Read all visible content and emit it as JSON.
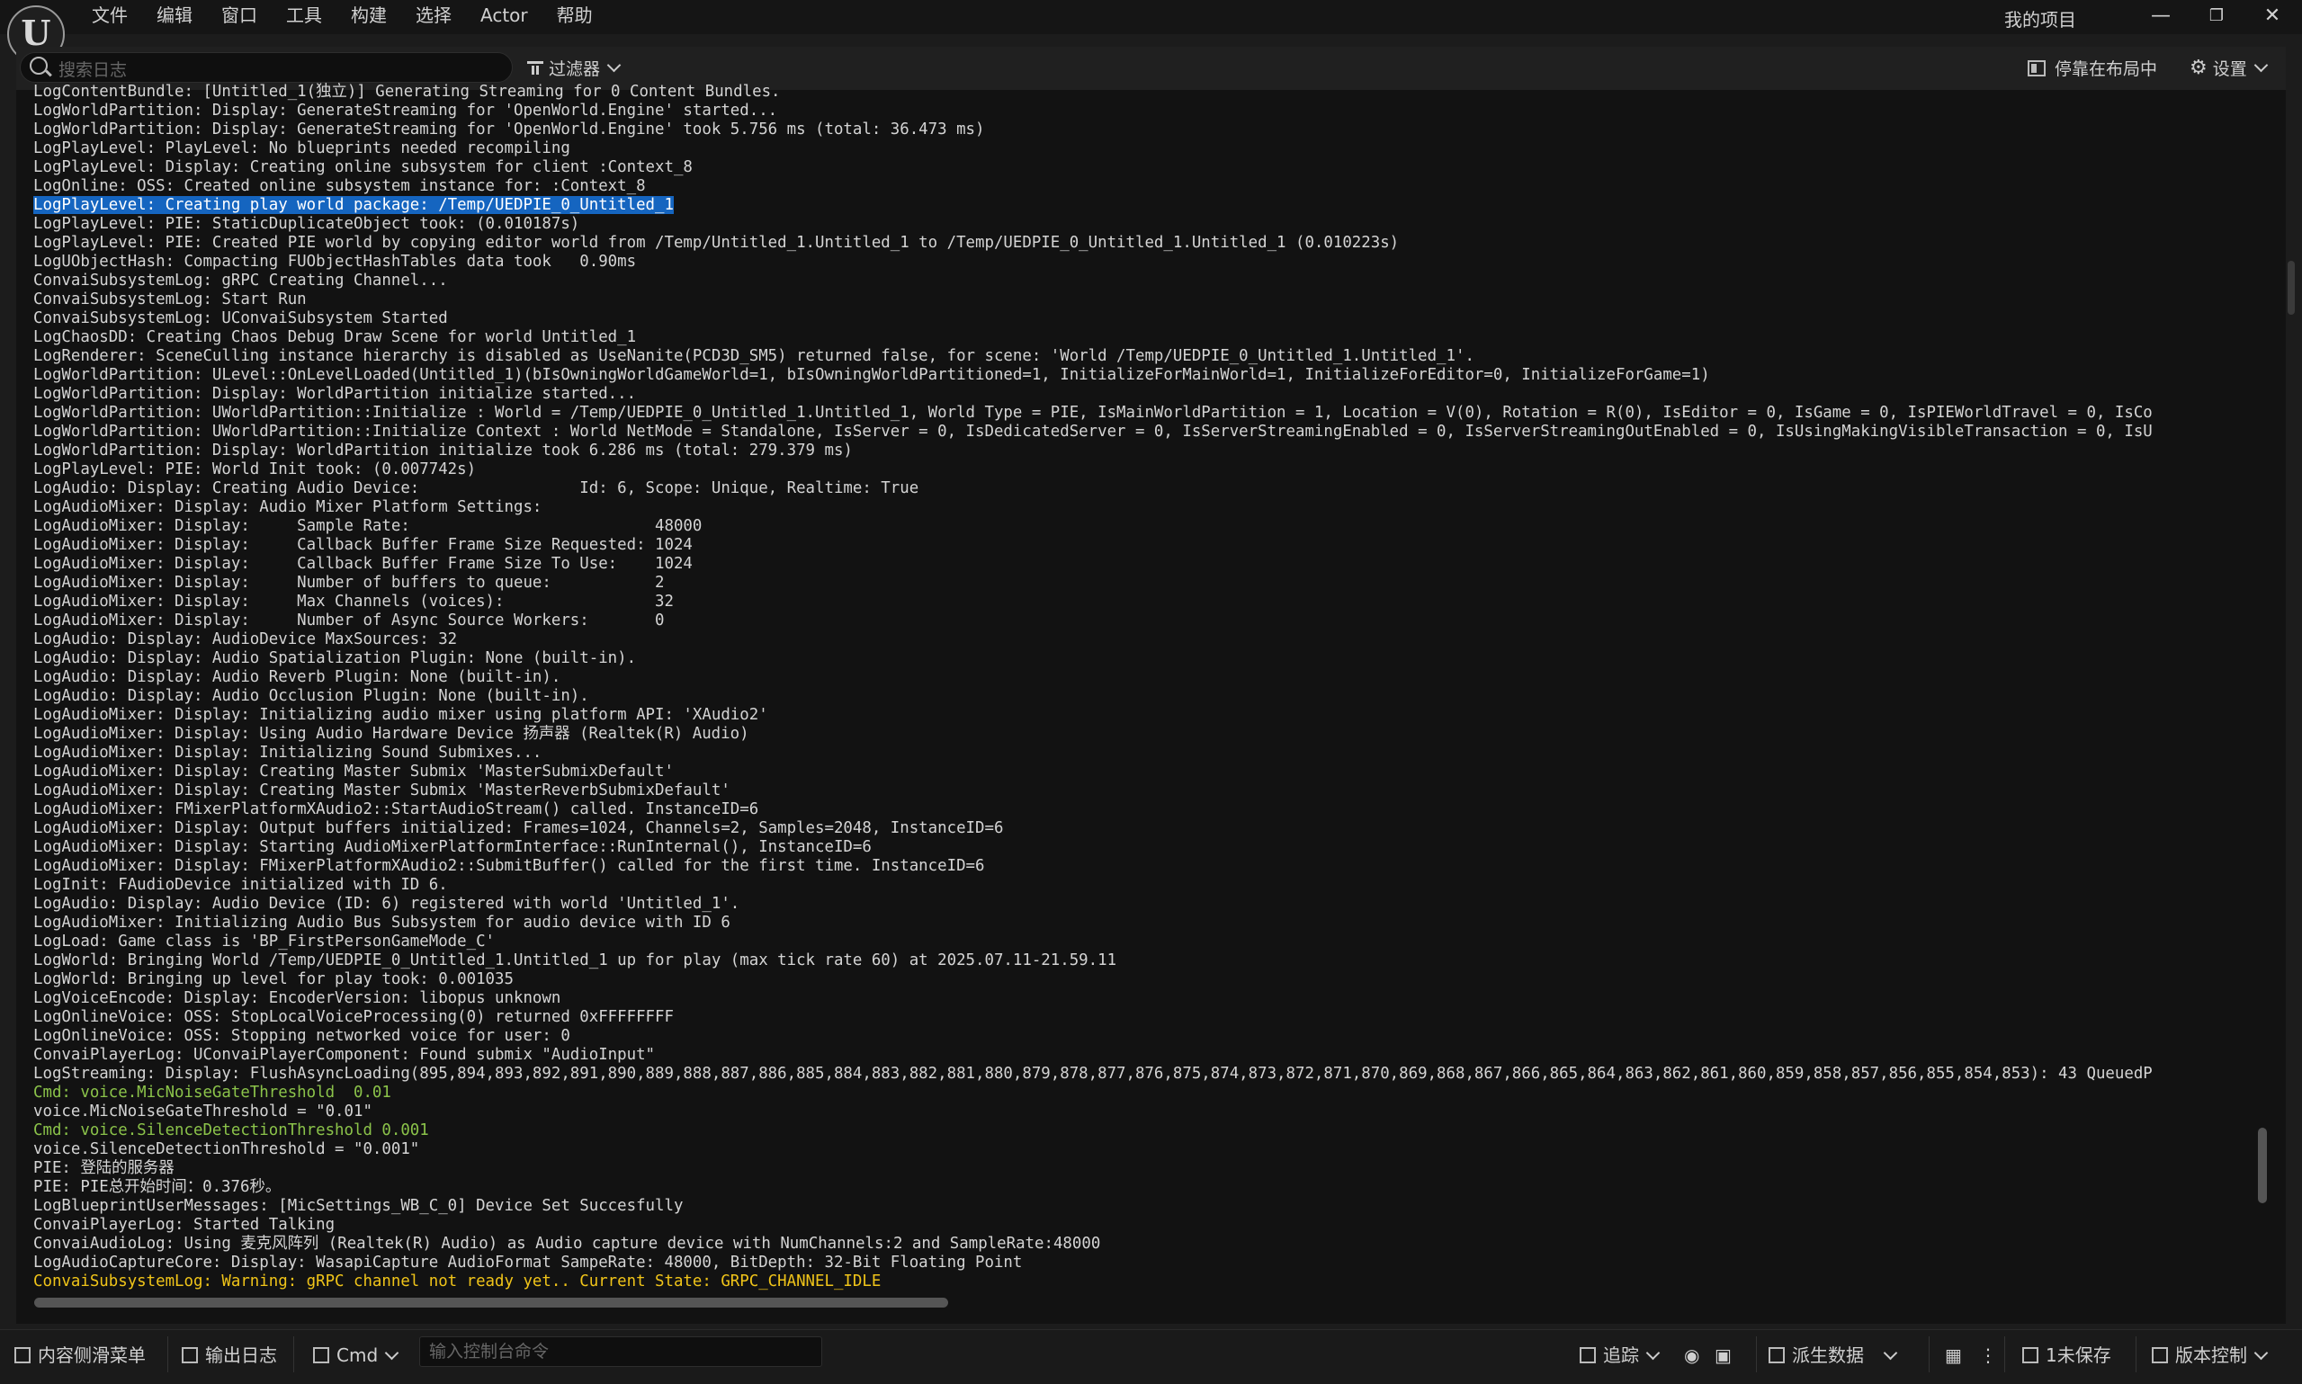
{
  "menu": {
    "items": [
      "文件",
      "编辑",
      "窗口",
      "工具",
      "构建",
      "选择",
      "Actor",
      "帮助"
    ],
    "project_name": "我的项目"
  },
  "toolbar": {
    "search_placeholder": "搜索日志",
    "filter_label": "过滤器",
    "dock_label": "停靠在布局中",
    "settings_label": "设置"
  },
  "log": {
    "lines": [
      {
        "text": "LogContentBundle: [Untitled_1(独立)] Generating Streaming for 0 Content Bundles.",
        "kind": "normal"
      },
      {
        "text": "LogWorldPartition: Display: GenerateStreaming for 'OpenWorld.Engine' started...",
        "kind": "normal"
      },
      {
        "text": "LogWorldPartition: Display: GenerateStreaming for 'OpenWorld.Engine' took 5.756 ms (total: 36.473 ms)",
        "kind": "normal"
      },
      {
        "text": "LogPlayLevel: PlayLevel: No blueprints needed recompiling",
        "kind": "normal"
      },
      {
        "text": "LogPlayLevel: Display: Creating online subsystem for client :Context_8",
        "kind": "normal"
      },
      {
        "text": "LogOnline: OSS: Created online subsystem instance for: :Context_8",
        "kind": "normal"
      },
      {
        "text": "LogPlayLevel: Creating play world package: /Temp/UEDPIE_0_Untitled_1",
        "kind": "selected"
      },
      {
        "text": "LogPlayLevel: PIE: StaticDuplicateObject took: (0.010187s)",
        "kind": "normal"
      },
      {
        "text": "LogPlayLevel: PIE: Created PIE world by copying editor world from /Temp/Untitled_1.Untitled_1 to /Temp/UEDPIE_0_Untitled_1.Untitled_1 (0.010223s)",
        "kind": "normal"
      },
      {
        "text": "LogUObjectHash: Compacting FUObjectHashTables data took   0.90ms",
        "kind": "normal"
      },
      {
        "text": "ConvaiSubsystemLog: gRPC Creating Channel...",
        "kind": "normal"
      },
      {
        "text": "ConvaiSubsystemLog: Start Run",
        "kind": "normal"
      },
      {
        "text": "ConvaiSubsystemLog: UConvaiSubsystem Started",
        "kind": "normal"
      },
      {
        "text": "LogChaosDD: Creating Chaos Debug Draw Scene for world Untitled_1",
        "kind": "normal"
      },
      {
        "text": "LogRenderer: SceneCulling instance hierarchy is disabled as UseNanite(PCD3D_SM5) returned false, for scene: 'World /Temp/UEDPIE_0_Untitled_1.Untitled_1'.",
        "kind": "normal"
      },
      {
        "text": "LogWorldPartition: ULevel::OnLevelLoaded(Untitled_1)(bIsOwningWorldGameWorld=1, bIsOwningWorldPartitioned=1, InitializeForMainWorld=1, InitializeForEditor=0, InitializeForGame=1)",
        "kind": "normal"
      },
      {
        "text": "LogWorldPartition: Display: WorldPartition initialize started...",
        "kind": "normal"
      },
      {
        "text": "LogWorldPartition: UWorldPartition::Initialize : World = /Temp/UEDPIE_0_Untitled_1.Untitled_1, World Type = PIE, IsMainWorldPartition = 1, Location = V(0), Rotation = R(0), IsEditor = 0, IsGame = 0, IsPIEWorldTravel = 0, IsCo",
        "kind": "normal"
      },
      {
        "text": "LogWorldPartition: UWorldPartition::Initialize Context : World NetMode = Standalone, IsServer = 0, IsDedicatedServer = 0, IsServerStreamingEnabled = 0, IsServerStreamingOutEnabled = 0, IsUsingMakingVisibleTransaction = 0, IsU",
        "kind": "normal"
      },
      {
        "text": "LogWorldPartition: Display: WorldPartition initialize took 6.286 ms (total: 279.379 ms)",
        "kind": "normal"
      },
      {
        "text": "LogPlayLevel: PIE: World Init took: (0.007742s)",
        "kind": "normal"
      },
      {
        "text": "LogAudio: Display: Creating Audio Device:                 Id: 6, Scope: Unique, Realtime: True",
        "kind": "normal"
      },
      {
        "text": "LogAudioMixer: Display: Audio Mixer Platform Settings:",
        "kind": "normal"
      },
      {
        "text": "LogAudioMixer: Display:     Sample Rate:                          48000",
        "kind": "normal"
      },
      {
        "text": "LogAudioMixer: Display:     Callback Buffer Frame Size Requested: 1024",
        "kind": "normal"
      },
      {
        "text": "LogAudioMixer: Display:     Callback Buffer Frame Size To Use:    1024",
        "kind": "normal"
      },
      {
        "text": "LogAudioMixer: Display:     Number of buffers to queue:           2",
        "kind": "normal"
      },
      {
        "text": "LogAudioMixer: Display:     Max Channels (voices):                32",
        "kind": "normal"
      },
      {
        "text": "LogAudioMixer: Display:     Number of Async Source Workers:       0",
        "kind": "normal"
      },
      {
        "text": "LogAudio: Display: AudioDevice MaxSources: 32",
        "kind": "normal"
      },
      {
        "text": "LogAudio: Display: Audio Spatialization Plugin: None (built-in).",
        "kind": "normal"
      },
      {
        "text": "LogAudio: Display: Audio Reverb Plugin: None (built-in).",
        "kind": "normal"
      },
      {
        "text": "LogAudio: Display: Audio Occlusion Plugin: None (built-in).",
        "kind": "normal"
      },
      {
        "text": "LogAudioMixer: Display: Initializing audio mixer using platform API: 'XAudio2'",
        "kind": "normal"
      },
      {
        "text": "LogAudioMixer: Display: Using Audio Hardware Device 扬声器 (Realtek(R) Audio)",
        "kind": "normal"
      },
      {
        "text": "LogAudioMixer: Display: Initializing Sound Submixes...",
        "kind": "normal"
      },
      {
        "text": "LogAudioMixer: Display: Creating Master Submix 'MasterSubmixDefault'",
        "kind": "normal"
      },
      {
        "text": "LogAudioMixer: Display: Creating Master Submix 'MasterReverbSubmixDefault'",
        "kind": "normal"
      },
      {
        "text": "LogAudioMixer: FMixerPlatformXAudio2::StartAudioStream() called. InstanceID=6",
        "kind": "normal"
      },
      {
        "text": "LogAudioMixer: Display: Output buffers initialized: Frames=1024, Channels=2, Samples=2048, InstanceID=6",
        "kind": "normal"
      },
      {
        "text": "LogAudioMixer: Display: Starting AudioMixerPlatformInterface::RunInternal(), InstanceID=6",
        "kind": "normal"
      },
      {
        "text": "LogAudioMixer: Display: FMixerPlatformXAudio2::SubmitBuffer() called for the first time. InstanceID=6",
        "kind": "normal"
      },
      {
        "text": "LogInit: FAudioDevice initialized with ID 6.",
        "kind": "normal"
      },
      {
        "text": "LogAudio: Display: Audio Device (ID: 6) registered with world 'Untitled_1'.",
        "kind": "normal"
      },
      {
        "text": "LogAudioMixer: Initializing Audio Bus Subsystem for audio device with ID 6",
        "kind": "normal"
      },
      {
        "text": "LogLoad: Game class is 'BP_FirstPersonGameMode_C'",
        "kind": "normal"
      },
      {
        "text": "LogWorld: Bringing World /Temp/UEDPIE_0_Untitled_1.Untitled_1 up for play (max tick rate 60) at 2025.07.11-21.59.11",
        "kind": "normal"
      },
      {
        "text": "LogWorld: Bringing up level for play took: 0.001035",
        "kind": "normal"
      },
      {
        "text": "LogVoiceEncode: Display: EncoderVersion: libopus unknown",
        "kind": "normal"
      },
      {
        "text": "LogOnlineVoice: OSS: StopLocalVoiceProcessing(0) returned 0xFFFFFFFF",
        "kind": "normal"
      },
      {
        "text": "LogOnlineVoice: OSS: Stopping networked voice for user: 0",
        "kind": "normal"
      },
      {
        "text": "ConvaiPlayerLog: UConvaiPlayerComponent: Found submix \"AudioInput\"",
        "kind": "normal"
      },
      {
        "text": "LogStreaming: Display: FlushAsyncLoading(895,894,893,892,891,890,889,888,887,886,885,884,883,882,881,880,879,878,877,876,875,874,873,872,871,870,869,868,867,866,865,864,863,862,861,860,859,858,857,856,855,854,853): 43 QueuedP",
        "kind": "normal"
      },
      {
        "text": "Cmd: voice.MicNoiseGateThreshold  0.01",
        "kind": "cmd"
      },
      {
        "text": "voice.MicNoiseGateThreshold = \"0.01\"",
        "kind": "normal"
      },
      {
        "text": "Cmd: voice.SilenceDetectionThreshold 0.001",
        "kind": "cmd"
      },
      {
        "text": "voice.SilenceDetectionThreshold = \"0.001\"",
        "kind": "normal"
      },
      {
        "text": "PIE: 登陆的服务器",
        "kind": "normal"
      },
      {
        "text": "PIE: PIE总开始时间：0.376秒。",
        "kind": "normal"
      },
      {
        "text": "LogBlueprintUserMessages: [MicSettings_WB_C_0] Device Set Succesfully",
        "kind": "normal"
      },
      {
        "text": "ConvaiPlayerLog: Started Talking",
        "kind": "normal"
      },
      {
        "text": "ConvaiAudioLog: Using 麦克风阵列 (Realtek(R) Audio) as Audio capture device with NumChannels:2 and SampleRate:48000",
        "kind": "normal"
      },
      {
        "text": "LogAudioCaptureCore: Display: WasapiCapture AudioFormat SampeRate: 48000, BitDepth: 32-Bit Floating Point",
        "kind": "normal"
      },
      {
        "text": "ConvaiSubsystemLog: Warning: gRPC channel not ready yet.. Current State: GRPC_CHANNEL_IDLE",
        "kind": "warning"
      }
    ]
  },
  "statusbar": {
    "content_drawer": "内容侧滑菜单",
    "output_log": "输出日志",
    "cmd_label": "Cmd",
    "console_placeholder": "输入控制台命令",
    "trace_label": "追踪",
    "derived_data": "派生数据",
    "unsaved": "1未保存",
    "source_control": "版本控制"
  }
}
